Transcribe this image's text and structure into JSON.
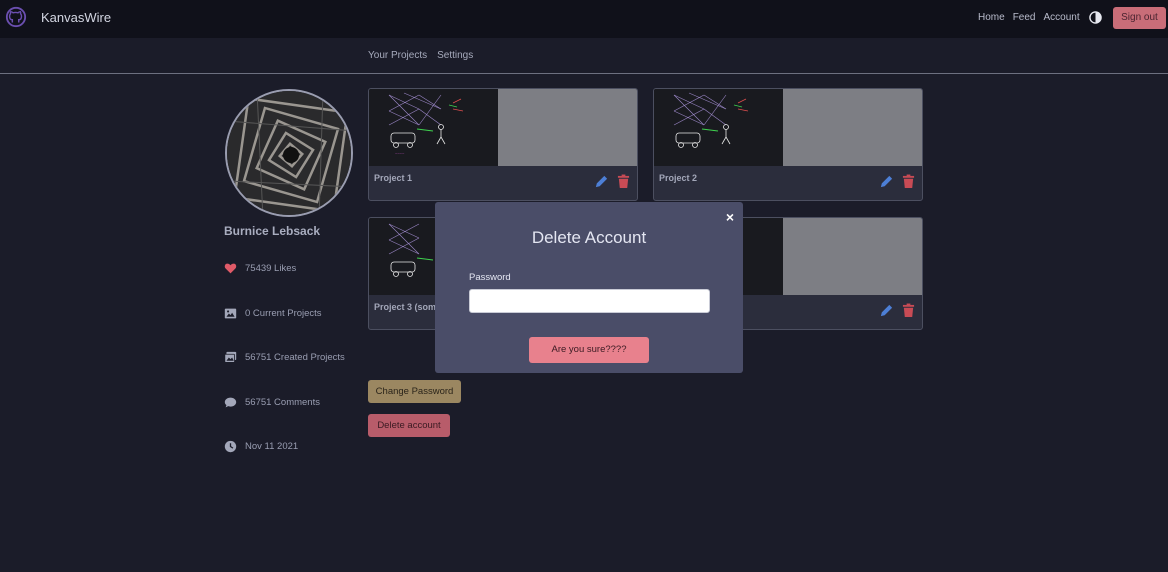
{
  "navbar": {
    "brand": "KanvasWire",
    "links": [
      "Home",
      "Feed",
      "Account"
    ],
    "signout_label": "Sign out"
  },
  "subnav": {
    "items": [
      "Your Projects",
      "Settings"
    ]
  },
  "profile": {
    "name": "Burnice Lebsack",
    "stats": [
      {
        "icon": "heart-icon",
        "text": "75439 Likes"
      },
      {
        "icon": "image-icon",
        "text": "0 Current Projects"
      },
      {
        "icon": "images-icon",
        "text": "56751 Created Projects"
      },
      {
        "icon": "comment-icon",
        "text": "56751 Comments"
      },
      {
        "icon": "clock-icon",
        "text": "Nov 11 2021"
      }
    ]
  },
  "projects": [
    {
      "title": "Project 1"
    },
    {
      "title": "Project 2"
    },
    {
      "title": "Project 3 (som"
    },
    {
      "title": ""
    }
  ],
  "actions": {
    "change_password": "Change Password",
    "delete_account": "Delete account"
  },
  "modal": {
    "title": "Delete Account",
    "close": "×",
    "password_label": "Password",
    "password_value": "",
    "confirm_label": "Are you sure????"
  },
  "colors": {
    "background": "#1b1c29",
    "navbar": "#10111a",
    "modal": "#4a4d68",
    "danger": "#e8818d",
    "edit_icon": "#4d7fd6",
    "delete_icon": "#c84b55",
    "heart": "#e05a68"
  }
}
